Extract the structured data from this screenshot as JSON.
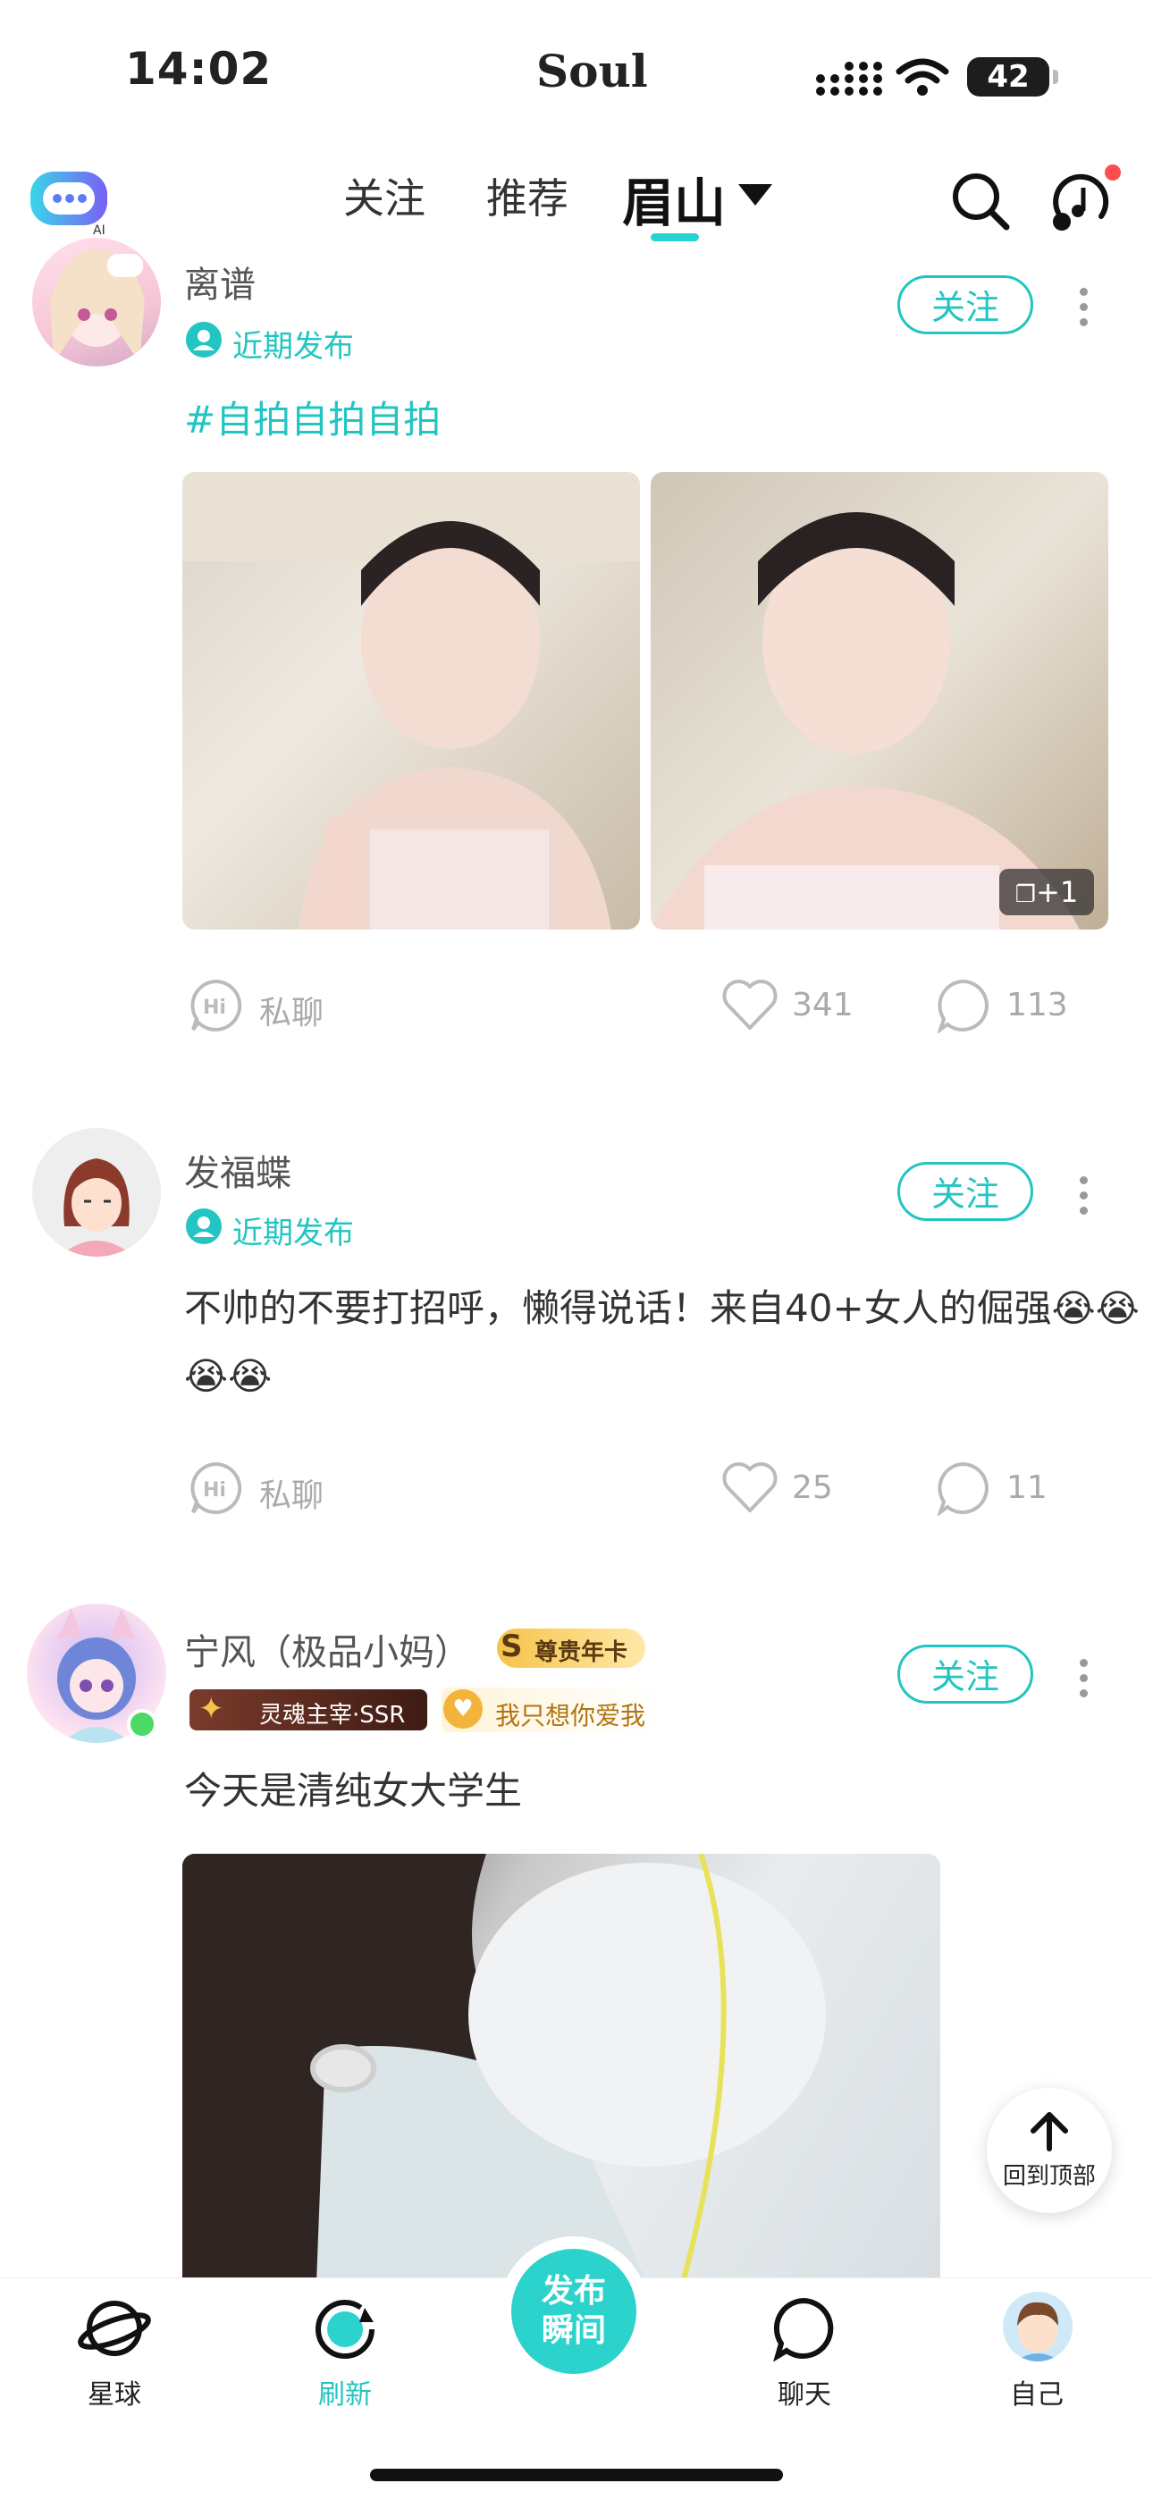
{
  "status_bar": {
    "time": "14:02",
    "app_name": "Soul",
    "battery": "42"
  },
  "top_nav": {
    "tabs": [
      {
        "label": "关注"
      },
      {
        "label": "推荐"
      },
      {
        "label": "眉山"
      }
    ],
    "logo_suffix": "AI"
  },
  "posts": [
    {
      "username": "离谱",
      "status": "近期发布",
      "follow_label": "关注",
      "hashtag": "#自拍自拍自拍",
      "more_images": "+1",
      "private_chat": "私聊",
      "likes": "341",
      "comments": "113"
    },
    {
      "username": "发福蝶",
      "status": "近期发布",
      "follow_label": "关注",
      "text": "不帅的不要打招呼，懒得说话！来自40+女人的倔强😭😭😭😭",
      "private_chat": "私聊",
      "likes": "25",
      "comments": "11"
    },
    {
      "username": "宁风（极品小妈）",
      "badge_vip": "尊贵年卡",
      "badge_level": "灵魂主宰·SSR",
      "badge_title": "我只想你爱我",
      "follow_label": "关注",
      "text": "今天是清纯女大学生"
    }
  ],
  "back_to_top": "回到顶部",
  "bottom_nav": {
    "tabs": [
      {
        "label": "星球"
      },
      {
        "label": "刷新"
      },
      {
        "label": "聊天"
      },
      {
        "label": "自己"
      }
    ],
    "publish_label_1": "发布",
    "publish_label_2": "瞬间"
  },
  "colors": {
    "accent": "#22c5c1",
    "notification": "#ff4d4f"
  }
}
